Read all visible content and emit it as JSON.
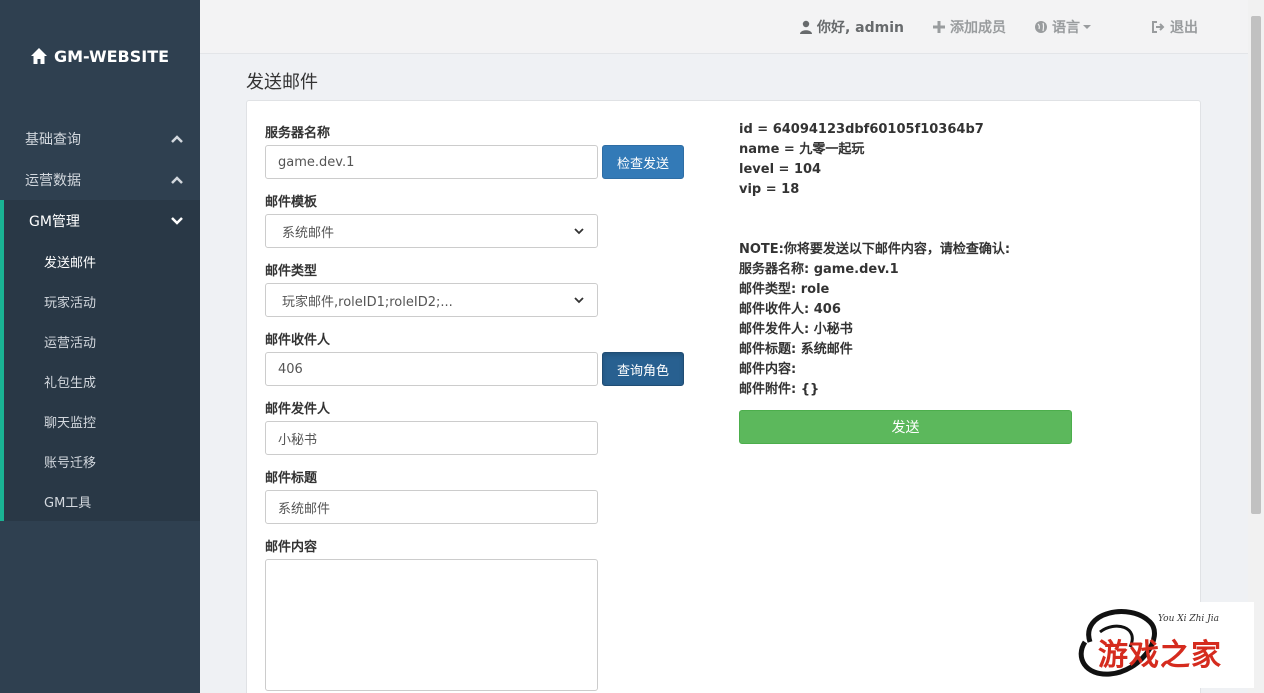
{
  "brand": {
    "title": "GM-WEBSITE"
  },
  "sidebar": {
    "items": [
      {
        "label": "基础查询"
      },
      {
        "label": "运营数据"
      },
      {
        "label": "GM管理"
      }
    ],
    "sub_items": [
      "发送邮件",
      "玩家活动",
      "运营活动",
      "礼包生成",
      "聊天监控",
      "账号迁移",
      "GM工具"
    ]
  },
  "topbar": {
    "greeting": "你好, admin",
    "add_member": "添加成员",
    "language": "语言",
    "logout": "退出"
  },
  "page": {
    "title": "发送邮件"
  },
  "form": {
    "server_label": "服务器名称",
    "server_value": "game.dev.1",
    "check_button": "检查发送",
    "template_label": "邮件模板",
    "template_value": "系统邮件",
    "type_label": "邮件类型",
    "type_value": "玩家邮件,roleID1;roleID2;...",
    "recipient_label": "邮件收件人",
    "recipient_value": "406",
    "query_button": "查询角色",
    "sender_label": "邮件发件人",
    "sender_value": "小秘书",
    "subject_label": "邮件标题",
    "subject_value": "系统邮件",
    "content_label": "邮件内容"
  },
  "role_info": {
    "id": "id = 64094123dbf60105f10364b7",
    "name": "name = 九零一起玩",
    "level": "level = 104",
    "vip": "vip = 18"
  },
  "confirm": {
    "note": "NOTE:你将要发送以下邮件内容，请检查确认:",
    "server": "服务器名称: game.dev.1",
    "type": "邮件类型: role",
    "recipient": "邮件收件人: 406",
    "sender": "邮件发件人: 小秘书",
    "subject": "邮件标题: 系统邮件",
    "content": "邮件内容:",
    "attachment": "邮件附件: {}",
    "send_button": "发送"
  },
  "watermark": {
    "text": "游戏之家",
    "sub": "You Xi Zhi Jia"
  }
}
